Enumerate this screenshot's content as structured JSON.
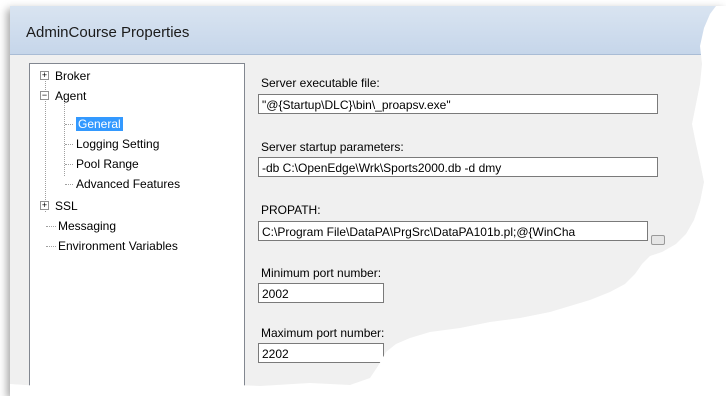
{
  "window": {
    "title": "AdminCourse Properties"
  },
  "tree": {
    "items": [
      {
        "label": "Broker",
        "expander": "+"
      },
      {
        "label": "Agent",
        "expander": "−"
      },
      {
        "label": "General",
        "selected": true
      },
      {
        "label": "Logging Setting"
      },
      {
        "label": "Pool Range"
      },
      {
        "label": "Advanced Features"
      },
      {
        "label": "SSL",
        "expander": "+"
      },
      {
        "label": "Messaging"
      },
      {
        "label": "Environment Variables"
      }
    ]
  },
  "form": {
    "server_executable": {
      "label": "Server executable file:",
      "value": "\"@{Startup\\DLC}\\bin\\_proapsv.exe\""
    },
    "startup_params": {
      "label": "Server startup parameters:",
      "value": "-db C:\\OpenEdge\\Wrk\\Sports2000.db -d dmy"
    },
    "propath": {
      "label": "PROPATH:",
      "value": "C:\\Program File\\DataPA\\PrgSrc\\DataPA101b.pl;@{WinCha"
    },
    "min_port": {
      "label": "Minimum port number:",
      "value": "2002"
    },
    "max_port": {
      "label": "Maximum port number:",
      "value": "2202"
    }
  },
  "icons": {
    "close": "close-icon",
    "expand": "plus-icon",
    "collapse": "minus-icon"
  }
}
